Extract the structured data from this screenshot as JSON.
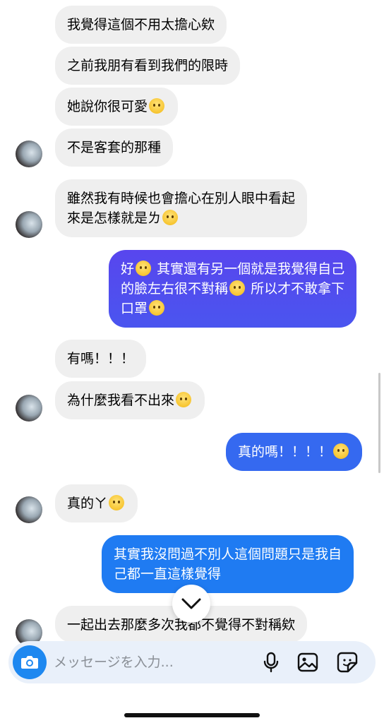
{
  "messages": [
    {
      "side": "in",
      "lines": [
        "我覺得這個不用太擔心欸"
      ]
    },
    {
      "side": "in",
      "lines": [
        "之前我朋有看到我們的限時"
      ]
    },
    {
      "side": "in",
      "lines": [
        "她說你很可愛"
      ]
    },
    {
      "side": "in",
      "lines": [
        "不是客套的那種"
      ]
    },
    {
      "side": "in",
      "lines": [
        "雖然我有時候也會擔心在別人眼中看起",
        "來是怎樣就是ㄌ"
      ]
    },
    {
      "side": "out",
      "lines": [
        "好",
        "其實還有另一個就是我覺得自己",
        "的臉左右很不對稱",
        "所以才不敢拿下",
        "口罩"
      ]
    },
    {
      "side": "in",
      "lines": [
        "有嗎！！！"
      ]
    },
    {
      "side": "in",
      "lines": [
        "為什麼我看不出來"
      ]
    },
    {
      "side": "out",
      "lines": [
        "真的嗎！！！！"
      ]
    },
    {
      "side": "in",
      "lines": [
        "真的ㄚ"
      ]
    },
    {
      "side": "out",
      "lines": [
        "其實我沒問過不別人這個問題只是我自",
        "己都一直這樣覺得"
      ]
    },
    {
      "side": "in",
      "lines": [
        "一起出去那麼多次我都不覺得不對稱欸"
      ]
    }
  ],
  "composer": {
    "placeholder": "メッセージを入力..."
  },
  "icons": {
    "camera": "camera-icon",
    "mic": "microphone-icon",
    "gallery": "gallery-icon",
    "sticker": "sticker-icon",
    "jump": "chevron-down-icon"
  },
  "colors": {
    "incoming_bubble": "#efefef",
    "outgoing_gradient_top": "#5b40f0",
    "outgoing_gradient_bottom": "#1f7bf2",
    "camera_button": "#1e88f0",
    "composer_bg": "#e9f0fa"
  }
}
